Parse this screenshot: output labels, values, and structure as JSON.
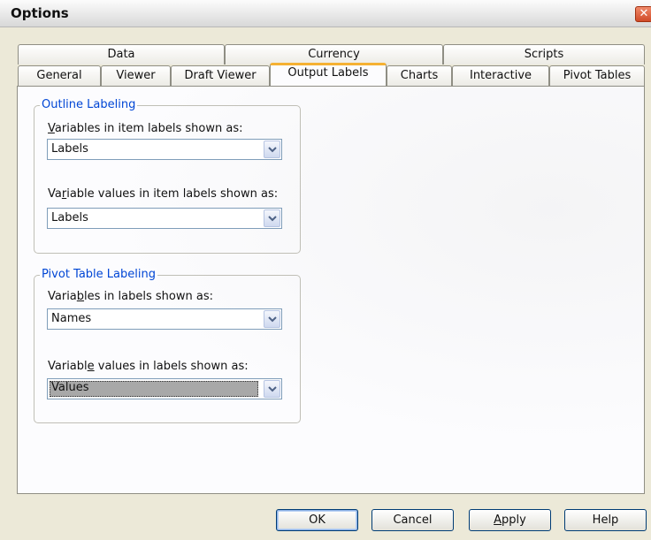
{
  "window": {
    "title": "Options",
    "close_symbol": "✕"
  },
  "tabs_row1": [
    {
      "label": "Data"
    },
    {
      "label": "Currency"
    },
    {
      "label": "Scripts"
    }
  ],
  "tabs_row2": [
    {
      "label": "General"
    },
    {
      "label": "Viewer"
    },
    {
      "label": "Draft Viewer"
    },
    {
      "label": "Output Labels",
      "active": true
    },
    {
      "label": "Charts"
    },
    {
      "label": "Interactive"
    },
    {
      "label": "Pivot Tables"
    }
  ],
  "outline": {
    "legend": "Outline Labeling",
    "variables_label_pre": "",
    "variables_label_u": "V",
    "variables_label_post": "ariables in item labels shown as:",
    "variables_value": "Labels",
    "values_label_pre": "Va",
    "values_label_u": "r",
    "values_label_post": "iable values in item labels shown as:",
    "values_value": "Labels"
  },
  "pivot": {
    "legend": "Pivot Table Labeling",
    "variables_label_pre": "Varia",
    "variables_label_u": "b",
    "variables_label_post": "les in labels shown as:",
    "variables_value": "Names",
    "values_label_pre": "Variabl",
    "values_label_u": "e",
    "values_label_post": " values in labels shown as:",
    "values_value": "Values"
  },
  "buttons": {
    "ok": "OK",
    "cancel": "Cancel",
    "apply_u": "A",
    "apply_rest": "pply",
    "help": "Help"
  }
}
